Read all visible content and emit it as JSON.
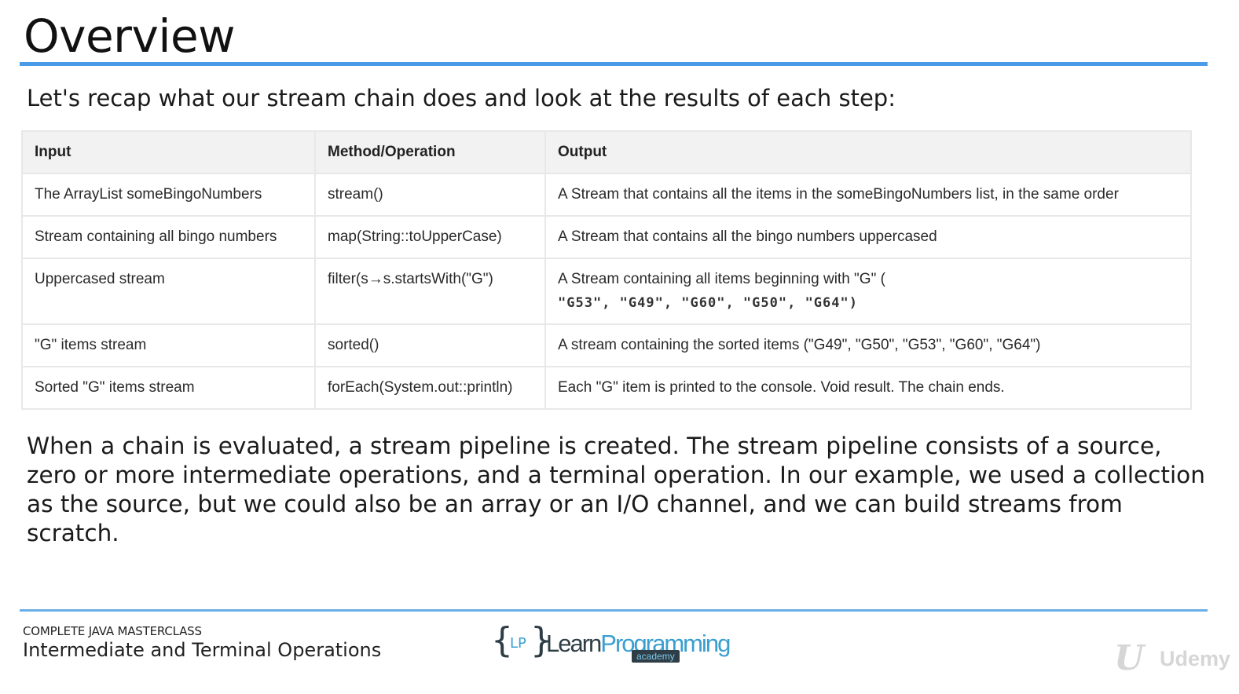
{
  "slide": {
    "title": "Overview",
    "intro": "Let's recap what our stream chain does and look at the results of each step:"
  },
  "table": {
    "headers": [
      "Input",
      "Method/Operation",
      "Output"
    ],
    "rows": [
      {
        "input": "The ArrayList someBingoNumbers",
        "method": "stream()",
        "output": "A Stream that contains all the items in the someBingoNumbers list, in the same order",
        "output_code": ""
      },
      {
        "input": "Stream containing all bingo numbers",
        "method": "map(String::toUpperCase)",
        "output": "A Stream that contains all the bingo numbers uppercased",
        "output_code": ""
      },
      {
        "input": "Uppercased stream",
        "method": "filter(s→s.startsWith(\"G\")",
        "output": "A Stream containing all items beginning with \"G\" (",
        "output_code": "\"G53\", \"G49\", \"G60\", \"G50\", \"G64\")"
      },
      {
        "input": "\"G\" items stream",
        "method": "sorted()",
        "output": "A stream containing the sorted items (\"G49\", \"G50\", \"G53\", \"G60\", \"G64\")",
        "output_code": ""
      },
      {
        "input": "Sorted \"G\" items stream",
        "method": "forEach(System.out::println)",
        "output": "Each \"G\" item is printed to the console. Void result. The chain ends.",
        "output_code": ""
      }
    ]
  },
  "body": {
    "paragraph": "When a chain is evaluated, a stream pipeline is created. The stream pipeline consists of a source, zero or more intermediate operations, and a terminal operation. In our example, we used a collection as the source, but we could also be an array or an I/O channel, and we can build streams from scratch."
  },
  "footer": {
    "course": "COMPLETE JAVA MASTERCLASS",
    "lecture": "Intermediate and Terminal Operations",
    "logo": {
      "brace_open": "{",
      "initials": "LP",
      "brace_close": "}",
      "word1": "Learn",
      "word2": "Programming",
      "sub": "academy"
    },
    "watermark": {
      "glyph": "U",
      "text": "Udemy"
    }
  },
  "colors": {
    "accent_rule": "#4a9be8",
    "logo_dark": "#2f3e46",
    "logo_blue": "#3a9fd0"
  }
}
